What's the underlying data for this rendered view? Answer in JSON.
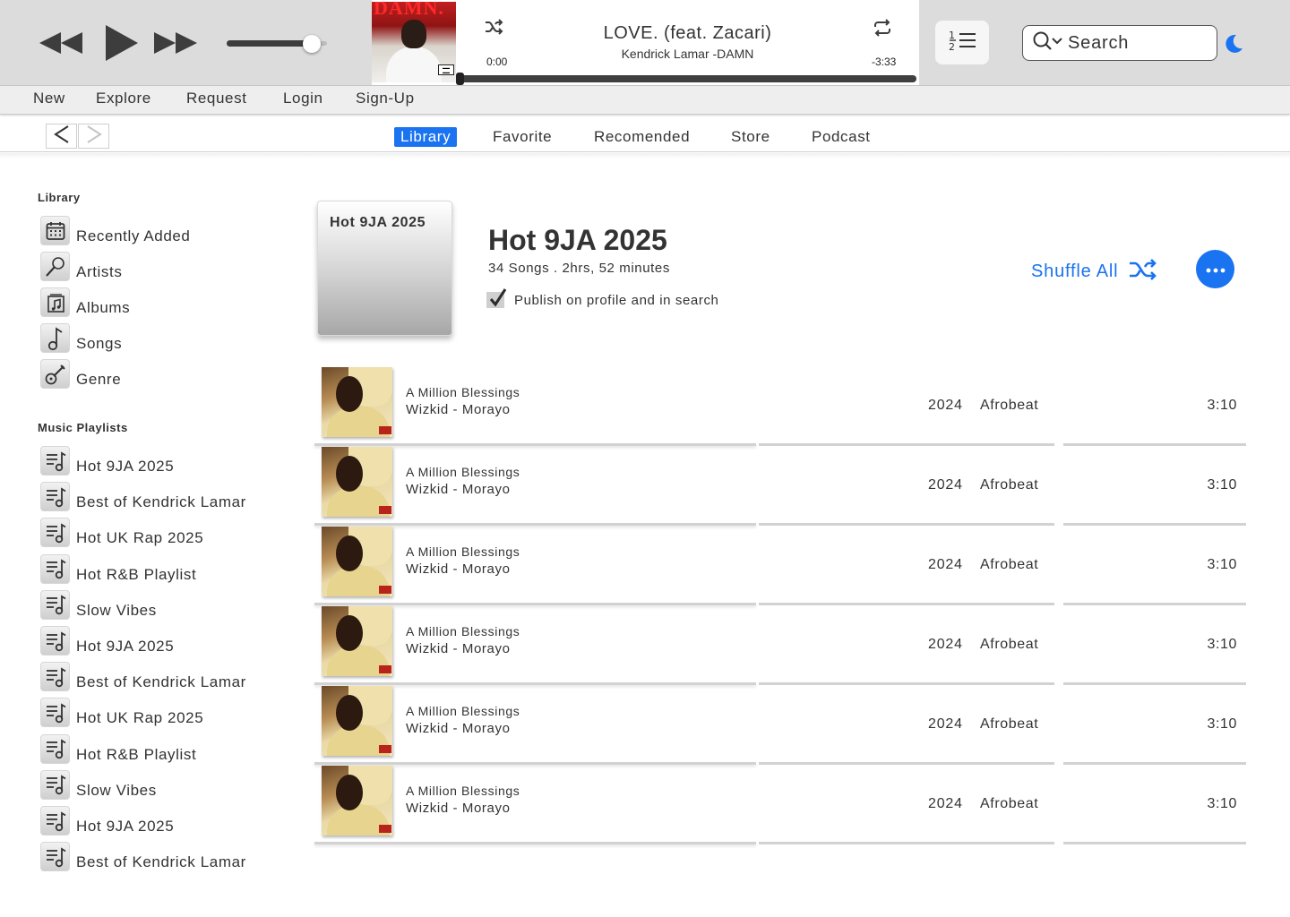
{
  "player": {
    "icons": {
      "previous": "rewind-icon",
      "play": "play-icon",
      "next": "fast-forward-icon",
      "shuffle": "shuffle-icon",
      "repeat": "repeat-icon",
      "queue": "numbered-list-icon",
      "search": "search-icon",
      "theme": "moon-icon"
    },
    "volume_level": 0.85,
    "now_playing": {
      "cover_logo": "DAMN.",
      "title": "LOVE. (feat. Zacari)",
      "artist": "Kendrick Lamar -DAMN",
      "elapsed": "0:00",
      "remaining": "-3:33",
      "progress": 0.0
    },
    "search": {
      "placeholder": "Search",
      "value": ""
    }
  },
  "menu": [
    "New",
    "Explore",
    "Request",
    "Login",
    "Sign-Up"
  ],
  "tabs": {
    "items": [
      "Library",
      "Favorite",
      "Recomended",
      "Store",
      "Podcast"
    ],
    "active": "Library"
  },
  "sidebar": {
    "library_heading": "Library",
    "library_items": [
      {
        "label": "Recently Added",
        "icon": "calendar-icon"
      },
      {
        "label": "Artists",
        "icon": "microphone-icon"
      },
      {
        "label": "Albums",
        "icon": "album-icon"
      },
      {
        "label": "Songs",
        "icon": "music-note-icon"
      },
      {
        "label": "Genre",
        "icon": "guitar-icon"
      }
    ],
    "playlists_heading": "Music Playlists",
    "playlist_icon": "playlist-icon",
    "playlists": [
      "Hot 9JA 2025",
      "Best of Kendrick Lamar",
      "Hot UK Rap 2025",
      "Hot R&B Playlist",
      "Slow Vibes",
      "Hot 9JA 2025",
      "Best of Kendrick Lamar",
      "Hot UK Rap 2025",
      "Hot R&B Playlist",
      "Slow Vibes",
      "Hot 9JA 2025",
      "Best of Kendrick Lamar"
    ]
  },
  "playlist": {
    "art_label": "Hot 9JA 2025",
    "title": "Hot 9JA 2025",
    "meta": "34 Songs . 2hrs, 52 minutes",
    "publish_label": "Publish on profile and in search",
    "publish_checked": true,
    "shuffle_label": "Shuffle All",
    "accent_color": "#1a73f0"
  },
  "tracks": [
    {
      "title": "A Million Blessings",
      "artist": "Wizkid - Morayo",
      "year": "2024",
      "genre": "Afrobeat",
      "duration": "3:10"
    },
    {
      "title": "A Million Blessings",
      "artist": "Wizkid - Morayo",
      "year": "2024",
      "genre": "Afrobeat",
      "duration": "3:10"
    },
    {
      "title": "A Million Blessings",
      "artist": "Wizkid - Morayo",
      "year": "2024",
      "genre": "Afrobeat",
      "duration": "3:10"
    },
    {
      "title": "A Million Blessings",
      "artist": "Wizkid - Morayo",
      "year": "2024",
      "genre": "Afrobeat",
      "duration": "3:10"
    },
    {
      "title": "A Million Blessings",
      "artist": "Wizkid - Morayo",
      "year": "2024",
      "genre": "Afrobeat",
      "duration": "3:10"
    },
    {
      "title": "A Million Blessings",
      "artist": "Wizkid - Morayo",
      "year": "2024",
      "genre": "Afrobeat",
      "duration": "3:10"
    }
  ]
}
